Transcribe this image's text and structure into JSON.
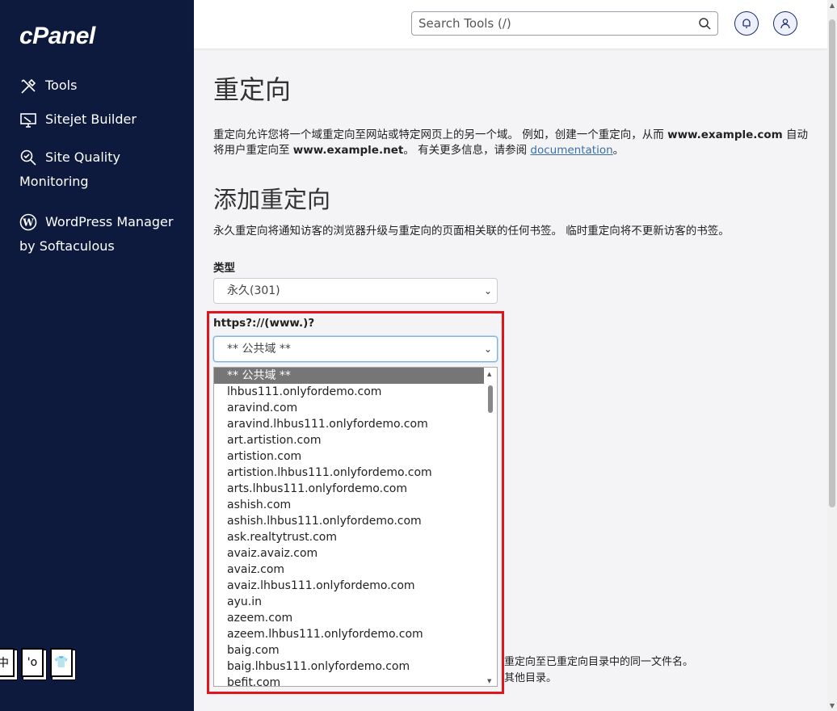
{
  "sidebar": {
    "logo": "cPanel",
    "items": [
      {
        "label": "Tools",
        "icon": "tools-icon"
      },
      {
        "label": "Sitejet Builder",
        "icon": "sitejet-icon"
      },
      {
        "label": "Site Quality",
        "label2": "Monitoring",
        "icon": "site-quality-icon"
      },
      {
        "label": "WordPress Manager",
        "label2": "by Softaculous",
        "icon": "wordpress-icon"
      }
    ],
    "bottom_icons": [
      "中",
      "'o",
      "👕"
    ]
  },
  "topbar": {
    "search_placeholder": "Search Tools (/)"
  },
  "page": {
    "title": "重定向",
    "desc_part1": "重定向允许您将一个域重定向至网站或特定网页上的另一个域。 例如，创建一个重定向，从而 ",
    "desc_example1": "www.example.com",
    "desc_part2": " 自动将用户重定向至 ",
    "desc_example2": "www.example.net",
    "desc_part3": "。 有关更多信息，请参阅 ",
    "desc_link": "documentation",
    "desc_end": "。",
    "section_title": "添加重定向",
    "section_desc": "永久重定向将通知访客的浏览器升级与重定向的页面相关联的任何书签。 临时重定向将不更新访客的书签。",
    "type_label": "类型",
    "type_value": "永久(301)",
    "domain_label": "https?://(www.)?",
    "domain_value": "** 公共域 **",
    "behind_text1": "重定向至已重定向目录中的同一文件名。",
    "behind_text2": "其他目录。"
  },
  "dropdown_options": [
    "** 公共域 **",
    "lhbus111.onlyfordemo.com",
    "aravind.com",
    "aravind.lhbus111.onlyfordemo.com",
    "art.artistion.com",
    "artistion.com",
    "artistion.lhbus111.onlyfordemo.com",
    "arts.lhbus111.onlyfordemo.com",
    "ashish.com",
    "ashish.lhbus111.onlyfordemo.com",
    "ask.realtytrust.com",
    "avaiz.avaiz.com",
    "avaiz.com",
    "avaiz.lhbus111.onlyfordemo.com",
    "ayu.in",
    "azeem.com",
    "azeem.lhbus111.onlyfordemo.com",
    "baig.com",
    "baig.lhbus111.onlyfordemo.com",
    "befit.com"
  ],
  "colors": {
    "sidebar_bg": "#0d1a3e",
    "highlight_box": "#e0141b",
    "selected_option": "#767676"
  }
}
